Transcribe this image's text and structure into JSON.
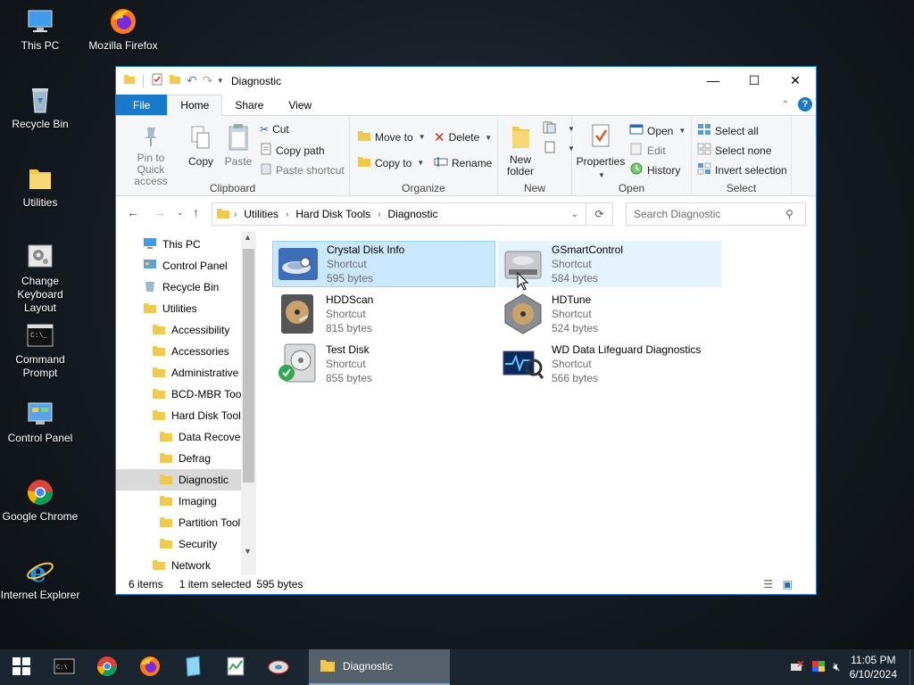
{
  "desktop": {
    "icons": [
      {
        "label": "This PC"
      },
      {
        "label": "Mozilla Firefox"
      },
      {
        "label": "Recycle Bin"
      },
      {
        "label": "Utilities"
      },
      {
        "label": "Change Keyboard Layout"
      },
      {
        "label": "Command Prompt"
      },
      {
        "label": "Control Panel"
      },
      {
        "label": "Google Chrome"
      },
      {
        "label": "Internet Explorer"
      }
    ]
  },
  "window": {
    "title": "Diagnostic",
    "tabs": {
      "file": "File",
      "home": "Home",
      "share": "Share",
      "view": "View"
    },
    "ribbon": {
      "clipboard": {
        "label": "Clipboard",
        "pin": "Pin to Quick access",
        "copy": "Copy",
        "paste": "Paste",
        "cut": "Cut",
        "copy_path": "Copy path",
        "paste_shortcut": "Paste shortcut"
      },
      "organize": {
        "label": "Organize",
        "move_to": "Move to",
        "copy_to": "Copy to",
        "delete": "Delete",
        "rename": "Rename"
      },
      "new": {
        "label": "New",
        "new_folder": "New folder"
      },
      "open": {
        "label": "Open",
        "properties": "Properties",
        "open": "Open",
        "edit": "Edit",
        "history": "History"
      },
      "select": {
        "label": "Select",
        "select_all": "Select all",
        "select_none": "Select none",
        "invert": "Invert selection"
      }
    },
    "address": {
      "crumbs": [
        "Utilities",
        "Hard Disk Tools",
        "Diagnostic"
      ]
    },
    "search": {
      "placeholder": "Search Diagnostic"
    },
    "nav": [
      {
        "label": "This PC"
      },
      {
        "label": "Control Panel"
      },
      {
        "label": "Recycle Bin"
      },
      {
        "label": "Utilities"
      },
      {
        "label": "Accessibility"
      },
      {
        "label": "Accessories"
      },
      {
        "label": "Administrative"
      },
      {
        "label": "BCD-MBR Tool"
      },
      {
        "label": "Hard Disk Tools"
      },
      {
        "label": "Data Recover"
      },
      {
        "label": "Defrag"
      },
      {
        "label": "Diagnostic"
      },
      {
        "label": "Imaging"
      },
      {
        "label": "Partition Tool"
      },
      {
        "label": "Security"
      },
      {
        "label": "Network"
      }
    ],
    "files": [
      {
        "name": "Crystal Disk Info",
        "type": "Shortcut",
        "size": "595 bytes"
      },
      {
        "name": "GSmartControl",
        "type": "Shortcut",
        "size": "584 bytes"
      },
      {
        "name": "HDDScan",
        "type": "Shortcut",
        "size": "815 bytes"
      },
      {
        "name": "HDTune",
        "type": "Shortcut",
        "size": "524 bytes"
      },
      {
        "name": "Test Disk",
        "type": "Shortcut",
        "size": "855 bytes"
      },
      {
        "name": "WD Data Lifeguard Diagnostics",
        "type": "Shortcut",
        "size": "566 bytes"
      }
    ],
    "status": {
      "items": "6 items",
      "selected": "1 item selected",
      "size": "595 bytes"
    }
  },
  "taskbar": {
    "task_label": "Diagnostic",
    "time": "11:05 PM",
    "date": "6/10/2024"
  }
}
